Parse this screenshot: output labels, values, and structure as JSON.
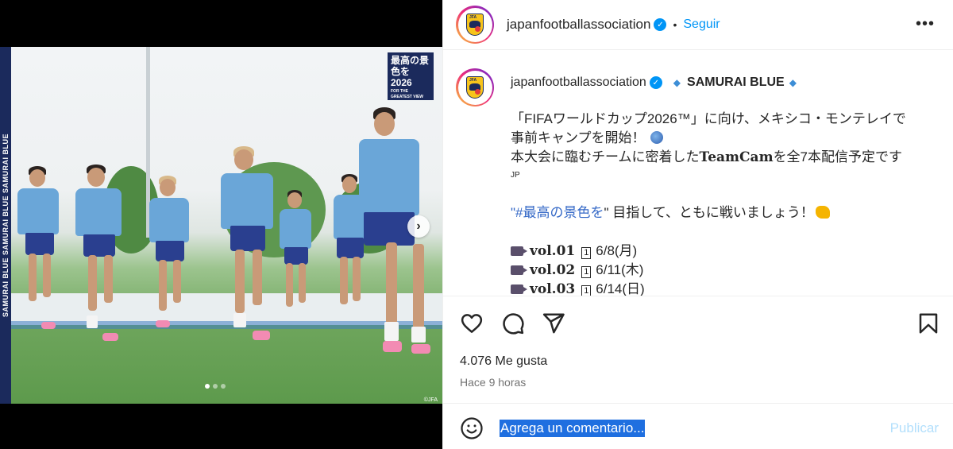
{
  "media": {
    "side_banner": "SAMURAI BLUE SAMURAI BLUE SAMURAI BLUE",
    "badge_title": "最高の景色を2026",
    "badge_sub": "FOR THE GREATEST VIEW",
    "next_arrow": "›",
    "copyright": "©JFA",
    "carousel_total": 3,
    "carousel_active": 1
  },
  "header": {
    "username": "japanfootballassociation",
    "verified_icon": "✓",
    "separator": "•",
    "follow_label": "Seguir",
    "more_label": "•••"
  },
  "caption": {
    "username": "japanfootballassociation",
    "verified_icon": "✓",
    "diamond": "◆",
    "team": "SAMURAI BLUE",
    "line1": "「FIFAワールドカップ2026™」に向け、メキシコ・モンテレイで",
    "line2": "事前キャンプを開始！",
    "line3_pre": "本大会に臨むチームに密着した",
    "line3_bold": "TeamCam",
    "line3_post": "を全7本配信予定です",
    "lang": "JP",
    "hashtag_open": "\"",
    "hashtag": "#最高の景色を",
    "hashtag_close": "\" 目指して、ともに戦いましょう！",
    "episodes": [
      {
        "vol": "vol.01",
        "num": "1",
        "date": "6/8(月)"
      },
      {
        "vol": "vol.02",
        "num": "1",
        "date": "6/11(木)"
      },
      {
        "vol": "vol.03",
        "num": "1",
        "date": "6/14(日)"
      }
    ]
  },
  "actions": {
    "like_icon": "heart-icon",
    "comment_icon": "comment-icon",
    "share_icon": "send-icon",
    "save_icon": "bookmark-icon"
  },
  "stats": {
    "likes": "4.076 Me gusta",
    "time_ago": "Hace 9 horas"
  },
  "comment": {
    "placeholder": "Agrega un comentario...",
    "publish_label": "Publicar"
  },
  "colors": {
    "accent": "#0095f6",
    "hashtag": "#3569c7",
    "publish_disabled": "#b2dffc",
    "jfa_navy": "#1b2a5c",
    "jfa_yellow": "#f7c41b"
  }
}
